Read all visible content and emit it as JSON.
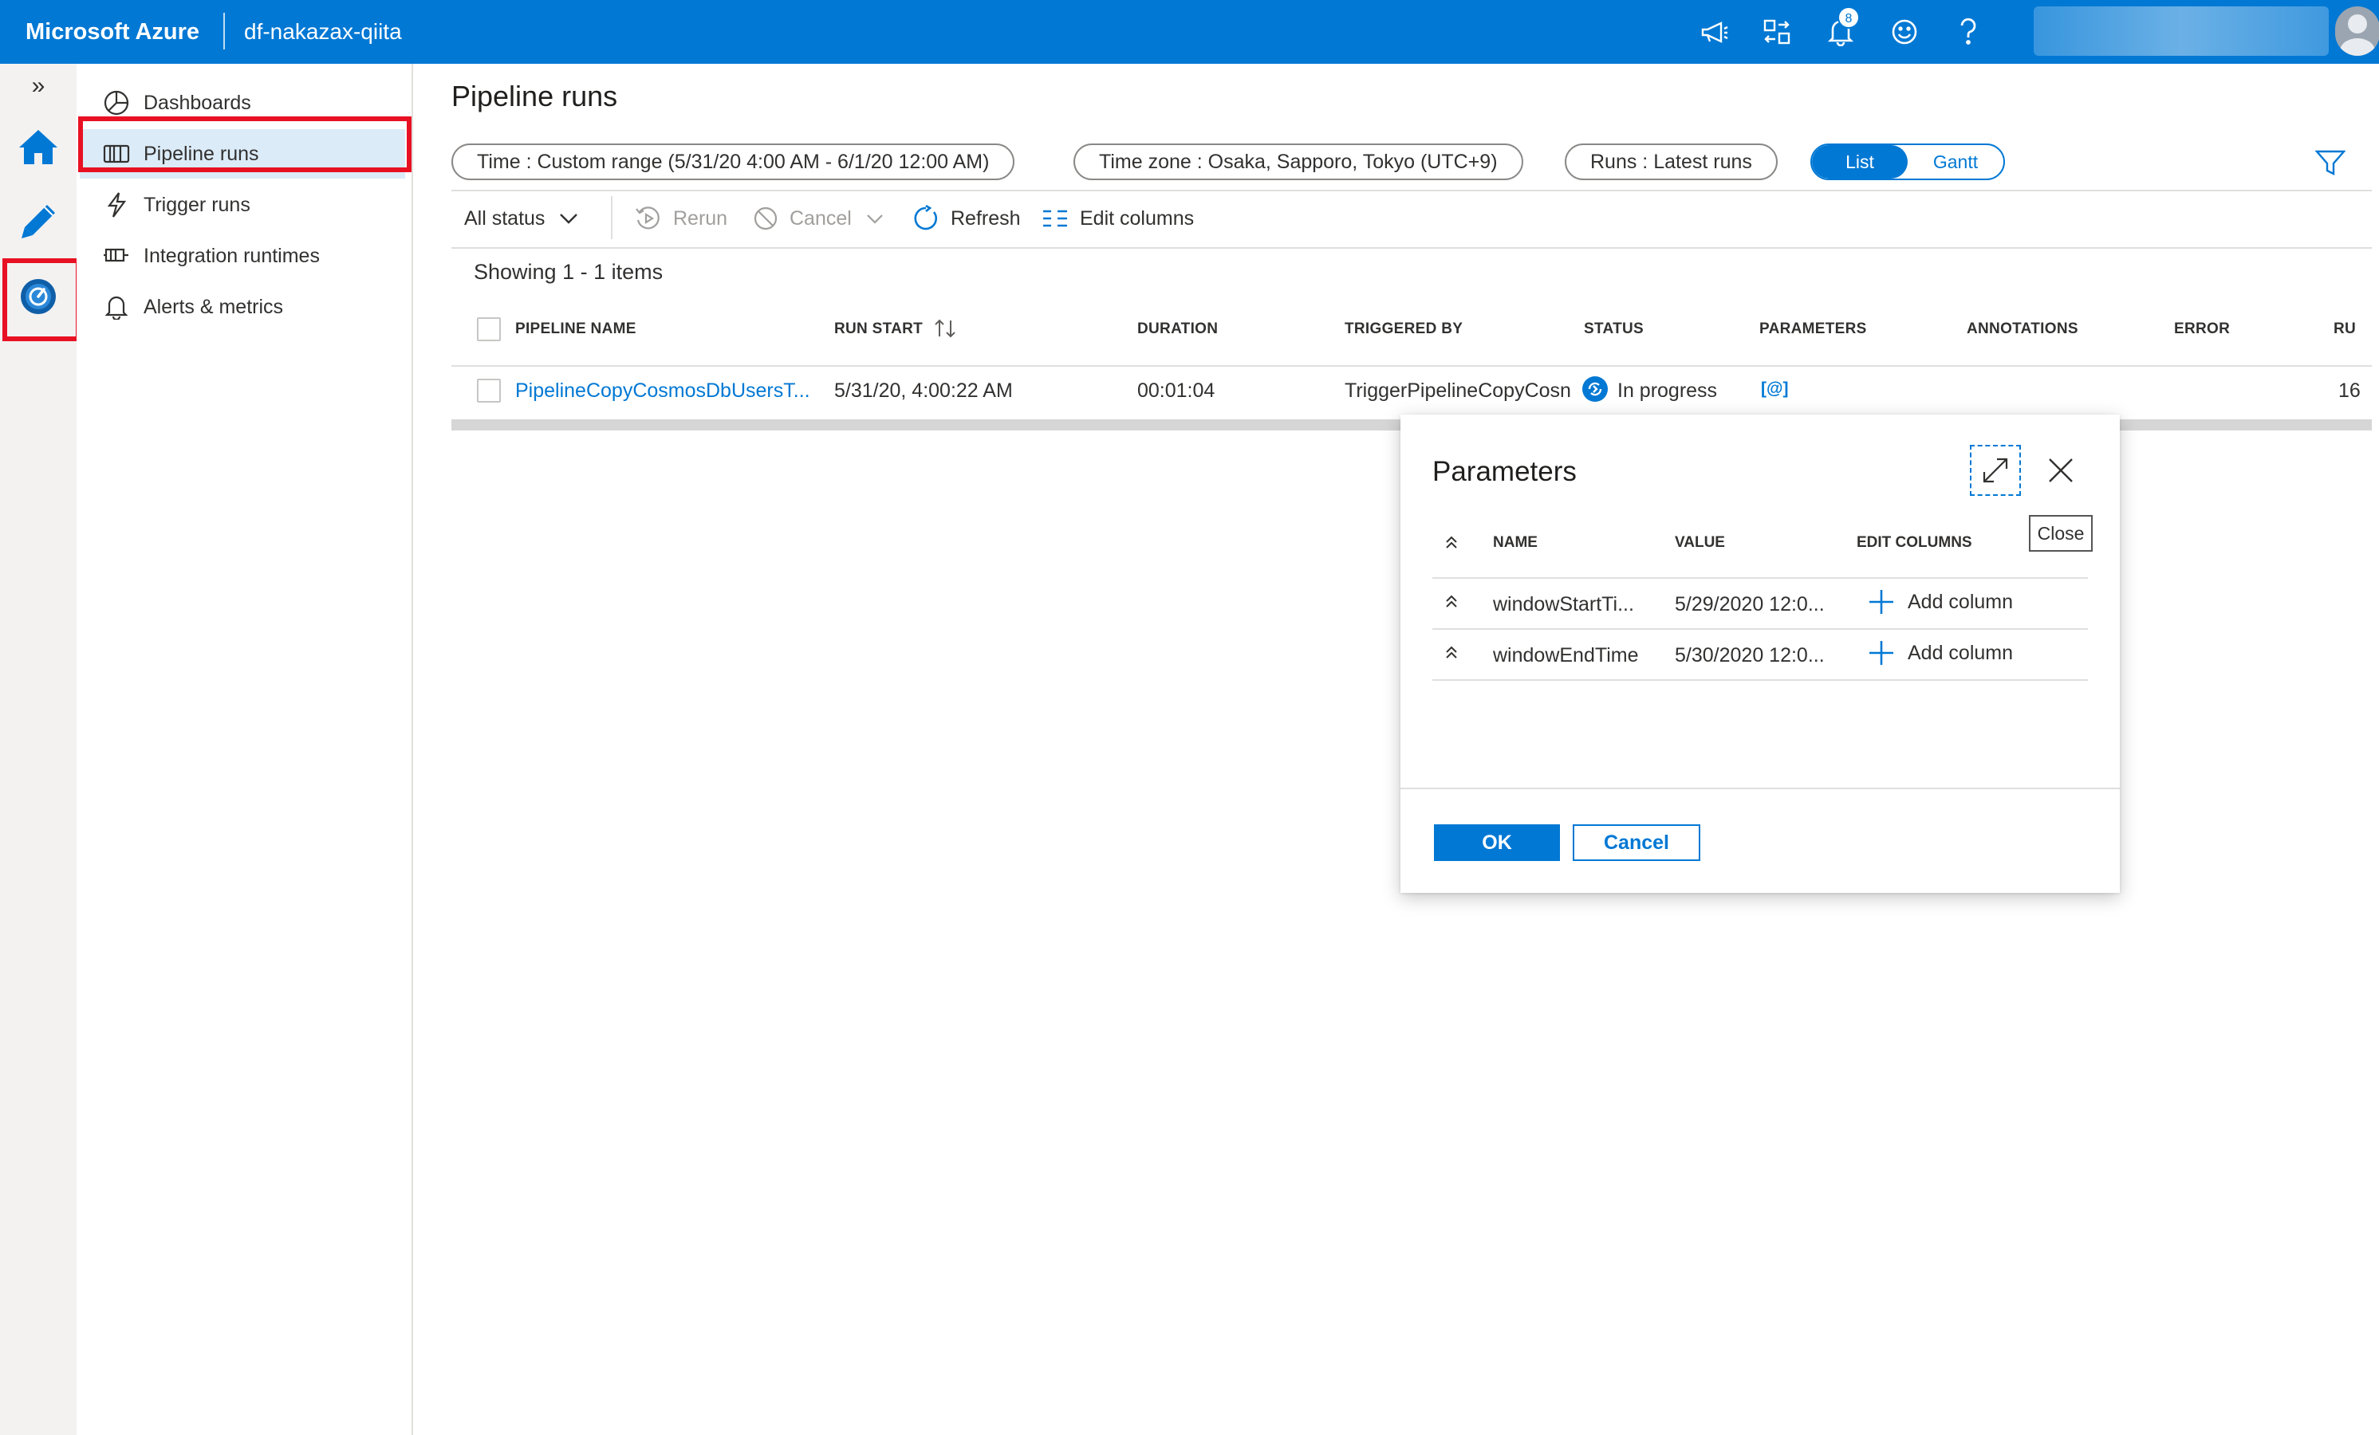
{
  "topbar": {
    "brand": "Microsoft Azure",
    "factory_name": "df-nakazax-qiita",
    "notification_count": "8",
    "icons": [
      "feedback-megaphone-icon",
      "directory-switch-icon",
      "bell-icon",
      "smiley-icon",
      "help-icon"
    ],
    "accent_color": "#0078d4"
  },
  "rail": {
    "collapse_glyph": "»",
    "items": [
      "home-icon",
      "author-pencil-icon",
      "monitor-gauge-icon"
    ]
  },
  "nav": {
    "items": [
      {
        "label": "Dashboards",
        "icon": "dashboard-icon"
      },
      {
        "label": "Pipeline runs",
        "icon": "pipeline-icon",
        "active": true
      },
      {
        "label": "Trigger runs",
        "icon": "trigger-icon"
      },
      {
        "label": "Integration runtimes",
        "icon": "runtime-icon"
      },
      {
        "label": "Alerts & metrics",
        "icon": "bell-icon"
      }
    ]
  },
  "main": {
    "title": "Pipeline runs",
    "filters": {
      "time_key": "Time : ",
      "time_value": "Custom range (5/31/20 4:00 AM - 6/1/20 12:00 AM)",
      "timezone_key": "Time zone : ",
      "timezone_value": "Osaka, Sapporo, Tokyo (UTC+9)",
      "runs_key": "Runs : ",
      "runs_value": "Latest runs",
      "view_list": "List",
      "view_gantt": "Gantt"
    },
    "toolbar": {
      "status": "All status",
      "rerun": "Rerun",
      "cancel": "Cancel",
      "refresh": "Refresh",
      "edit_columns": "Edit columns"
    },
    "showing": "Showing 1 - 1 items",
    "table": {
      "columns": [
        "PIPELINE NAME",
        "RUN START",
        "DURATION",
        "TRIGGERED BY",
        "STATUS",
        "PARAMETERS",
        "ANNOTATIONS",
        "ERROR",
        "RU"
      ],
      "rows": [
        {
          "pipeline_name": "PipelineCopyCosmosDbUsersT...",
          "run_start": "5/31/20, 4:00:22 AM",
          "duration": "00:01:04",
          "triggered_by": "TriggerPipelineCopyCosn",
          "status": "In progress",
          "parameters": "[@]",
          "ru": "16"
        }
      ]
    }
  },
  "dialog": {
    "title": "Parameters",
    "close_tooltip": "Close",
    "columns": [
      "NAME",
      "VALUE",
      "EDIT COLUMNS"
    ],
    "rows": [
      {
        "name": "windowStartTi...",
        "value": "5/29/2020 12:0...",
        "action": "Add column"
      },
      {
        "name": "windowEndTime",
        "value": "5/30/2020 12:0...",
        "action": "Add column"
      }
    ],
    "ok": "OK",
    "cancel": "Cancel"
  }
}
